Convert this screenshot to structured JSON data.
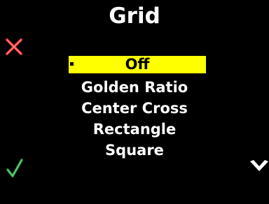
{
  "screen": {
    "title": "Grid"
  },
  "menu": {
    "items": [
      {
        "label": "Off",
        "selected": true
      },
      {
        "label": "Golden Ratio",
        "selected": false
      },
      {
        "label": "Center Cross",
        "selected": false
      },
      {
        "label": "Rectangle",
        "selected": false
      },
      {
        "label": "Square",
        "selected": false
      }
    ]
  },
  "icons": {
    "close": "close-icon",
    "confirm": "checkmark-icon",
    "down": "chevron-down-icon"
  },
  "colors": {
    "background": "#000000",
    "text": "#ffffff",
    "highlight": "#ffff00",
    "close": "#e8322e",
    "confirm": "#2aa84a"
  }
}
